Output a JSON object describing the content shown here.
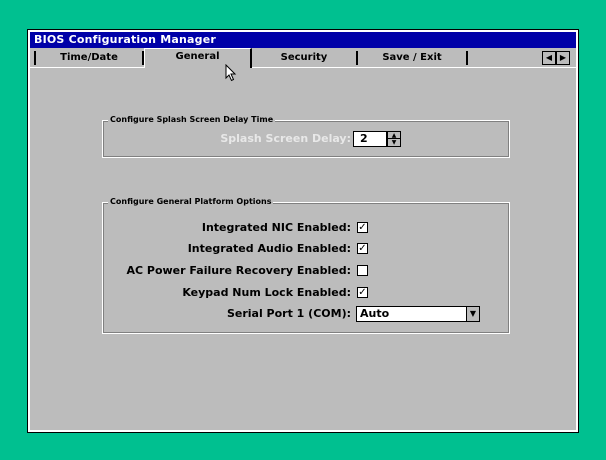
{
  "window": {
    "title": "BIOS Configuration Manager"
  },
  "tabs": [
    {
      "label": "Time/Date",
      "active": false
    },
    {
      "label": "General",
      "active": true
    },
    {
      "label": "Security",
      "active": false
    },
    {
      "label": "Save / Exit",
      "active": false
    }
  ],
  "tab_scroll": {
    "left_icon": "◀",
    "right_icon": "▶"
  },
  "splash_group": {
    "title": "Configure Splash Screen Delay Time",
    "delay_label": "Splash Screen Delay:",
    "delay_value": "2",
    "up_icon": "▲",
    "down_icon": "▼"
  },
  "platform_group": {
    "title": "Configure General Platform Options",
    "options": [
      {
        "label": "Integrated NIC Enabled:",
        "checked": true
      },
      {
        "label": "Integrated Audio Enabled:",
        "checked": true
      },
      {
        "label": "AC Power Failure Recovery Enabled:",
        "checked": false
      },
      {
        "label": "Keypad Num Lock Enabled:",
        "checked": true
      }
    ],
    "serial_label": "Serial Port 1 (COM):",
    "serial_value": "Auto",
    "dropdown_icon": "▼"
  },
  "colors": {
    "desktop": "#00c090",
    "window_bg": "#bcbcbc",
    "titlebar": "#0000a8"
  }
}
